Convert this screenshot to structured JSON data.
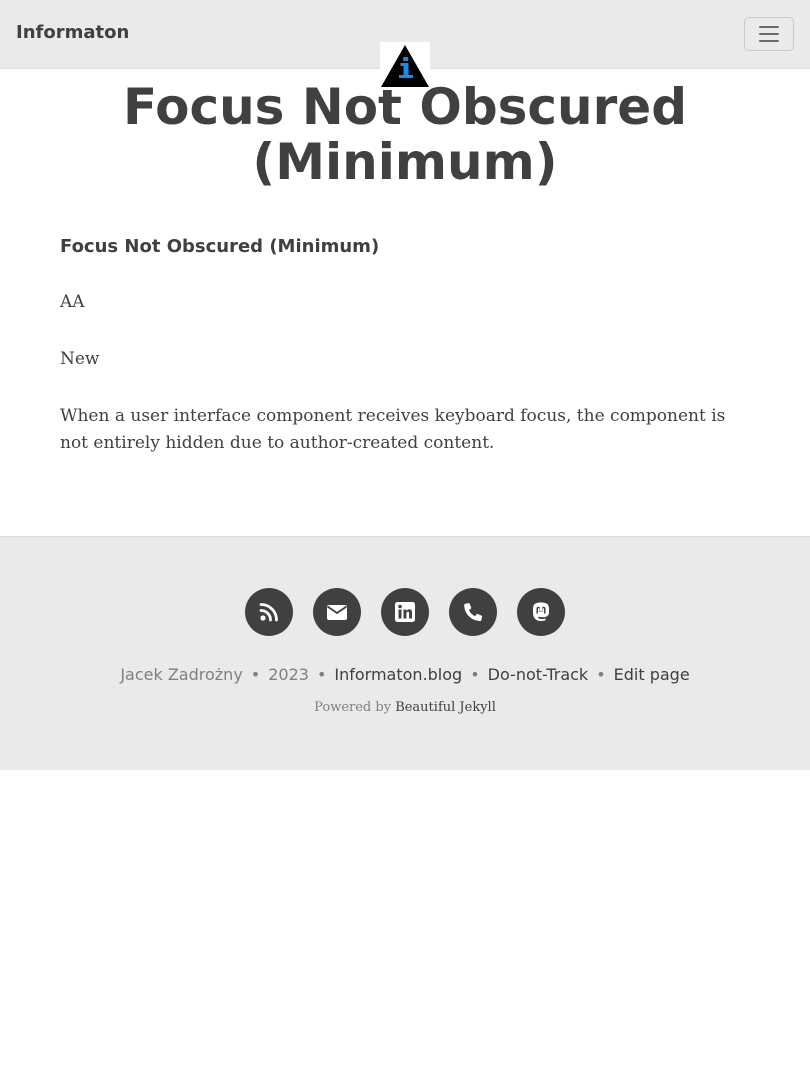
{
  "navbar": {
    "brand": "Informaton",
    "menu_icon": "hamburger-menu-icon"
  },
  "avatar": {
    "icon": "info-triangle-logo",
    "colors": {
      "triangle": "#000000",
      "info": "#1e88e5"
    }
  },
  "page": {
    "title": "Focus Not Obscured (Minimum)"
  },
  "content": {
    "heading": "Focus Not Obscured (Minimum)",
    "level": "AA",
    "status": "New",
    "description": "When a user interface component receives keyboard focus, the component is not entirely hidden due to author-created content."
  },
  "footer": {
    "social": [
      {
        "name": "rss-icon"
      },
      {
        "name": "envelope-icon"
      },
      {
        "name": "linkedin-icon"
      },
      {
        "name": "phone-icon"
      },
      {
        "name": "mastodon-icon"
      }
    ],
    "author": "Jacek Zadrożny",
    "year": "2023",
    "site_link": "Informaton.blog",
    "dnt_link": "Do-not-Track",
    "edit_link": "Edit page",
    "separator": "•",
    "powered_prefix": "Powered by",
    "powered_link": "Beautiful Jekyll"
  },
  "colors": {
    "navbar_bg": "#eaeaea",
    "footer_bg": "#eaeaea",
    "text": "#404040",
    "muted": "#808080"
  }
}
